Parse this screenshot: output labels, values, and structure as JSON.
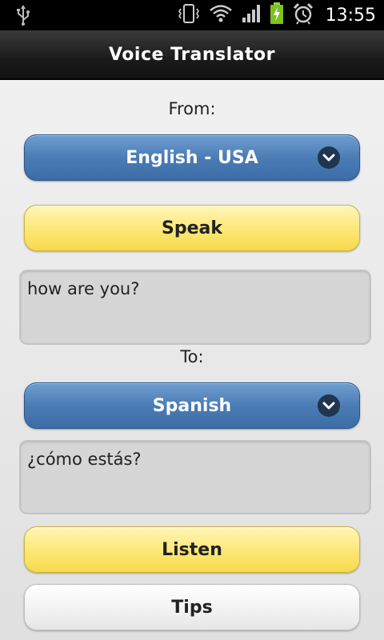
{
  "status_bar": {
    "time": "13:55",
    "icons": [
      "usb-icon",
      "vibrate-icon",
      "wifi-icon",
      "signal-icon",
      "battery-charging-icon",
      "alarm-icon"
    ]
  },
  "app": {
    "title": "Voice Translator"
  },
  "from": {
    "label": "From:",
    "language": "English - USA"
  },
  "speak_button": "Speak",
  "source_text": "how are you?",
  "to": {
    "label": "To:",
    "language": "Spanish"
  },
  "translated_text": "¿cómo estás?",
  "listen_button": "Listen",
  "tips_button": "Tips",
  "colors": {
    "select_blue": "#4b7cb5",
    "button_yellow": "#fde97a",
    "text_box_gray": "#d6d6d6"
  }
}
